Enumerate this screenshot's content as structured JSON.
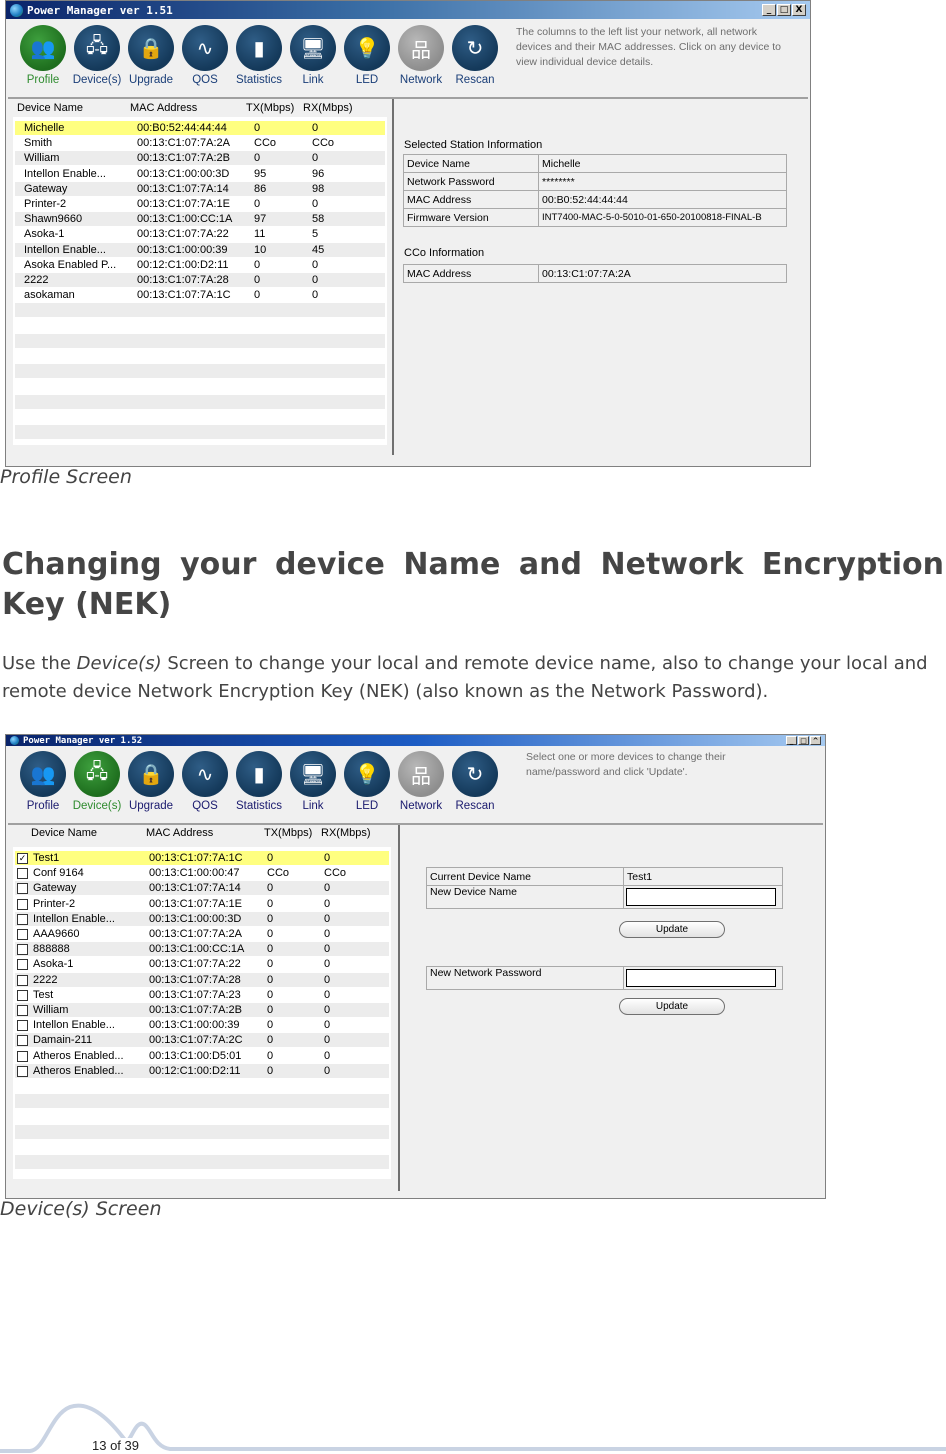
{
  "screen1": {
    "title": "Power Manager ver 1.51",
    "window_buttons": [
      "_",
      "□",
      "X"
    ],
    "toolbar": [
      {
        "label": "Profile",
        "icon": "profile-icon",
        "glyph": "👥",
        "active": true
      },
      {
        "label": "Device(s)",
        "icon": "devices-icon",
        "glyph": "🖧",
        "active": false
      },
      {
        "label": "Upgrade",
        "icon": "upgrade-icon",
        "glyph": "🔒",
        "active": false
      },
      {
        "label": "QOS",
        "icon": "qos-icon",
        "glyph": "∿",
        "active": false
      },
      {
        "label": "Statistics",
        "icon": "statistics-icon",
        "glyph": "▮",
        "active": false
      },
      {
        "label": "Link",
        "icon": "link-icon",
        "glyph": "🖥",
        "active": false
      },
      {
        "label": "LED",
        "icon": "led-icon",
        "glyph": "💡",
        "active": false
      },
      {
        "label": "Network",
        "icon": "network-icon",
        "glyph": "品",
        "active": false,
        "disabled": true
      },
      {
        "label": "Rescan",
        "icon": "rescan-icon",
        "glyph": "↻",
        "active": false
      }
    ],
    "hint": "The columns to the left list your network, all network devices and their MAC addresses. Click on any device to view individual device details.",
    "columns": [
      "Device Name",
      "MAC Address",
      "TX(Mbps)",
      "RX(Mbps)"
    ],
    "rows": [
      {
        "name": "Michelle",
        "mac": "00:B0:52:44:44:44",
        "tx": "0",
        "rx": "0",
        "selected": true
      },
      {
        "name": "Smith",
        "mac": "00:13:C1:07:7A:2A",
        "tx": "CCo",
        "rx": "CCo"
      },
      {
        "name": "William",
        "mac": "00:13:C1:07:7A:2B",
        "tx": "0",
        "rx": "0"
      },
      {
        "name": "Intellon Enable...",
        "mac": "00:13:C1:00:00:3D",
        "tx": "95",
        "rx": "96"
      },
      {
        "name": "Gateway",
        "mac": "00:13:C1:07:7A:14",
        "tx": "86",
        "rx": "98"
      },
      {
        "name": "Printer-2",
        "mac": "00:13:C1:07:7A:1E",
        "tx": "0",
        "rx": "0"
      },
      {
        "name": "Shawn9660",
        "mac": "00:13:C1:00:CC:1A",
        "tx": "97",
        "rx": "58"
      },
      {
        "name": "Asoka-1",
        "mac": "00:13:C1:07:7A:22",
        "tx": "11",
        "rx": "5"
      },
      {
        "name": "Intellon Enable...",
        "mac": "00:13:C1:00:00:39",
        "tx": "10",
        "rx": "45"
      },
      {
        "name": "Asoka Enabled P...",
        "mac": "00:12:C1:00:D2:11",
        "tx": "0",
        "rx": "0"
      },
      {
        "name": "2222",
        "mac": "00:13:C1:07:7A:28",
        "tx": "0",
        "rx": "0"
      },
      {
        "name": "asokaman",
        "mac": "00:13:C1:07:7A:1C",
        "tx": "0",
        "rx": "0"
      }
    ],
    "empty_rows": 10,
    "station_info": {
      "title": "Selected Station Information",
      "fields": [
        {
          "label": "Device Name",
          "value": "Michelle"
        },
        {
          "label": "Network Password",
          "value": "********"
        },
        {
          "label": "MAC Address",
          "value": "00:B0:52:44:44:44"
        },
        {
          "label": "Firmware Version",
          "value": "INT7400-MAC-5-0-5010-01-650-20100818-FINAL-B"
        }
      ]
    },
    "cco_info": {
      "title": "CCo Information",
      "fields": [
        {
          "label": "MAC Address",
          "value": "00:13:C1:07:7A:2A"
        }
      ]
    },
    "caption": "Profile Screen"
  },
  "section": {
    "heading_line1_words": [
      "Changing",
      "your",
      "device",
      "Name",
      "and",
      "Network",
      "Encryption"
    ],
    "heading_line2": "Key (NEK)",
    "para_pre": "Use the ",
    "para_em": "Device(s)",
    "para_post": " Screen to change your local and remote device name, also to change your local and remote device Network Encryption Key (NEK) (also known as the Network Password)."
  },
  "screen2": {
    "title": "Power Manager ver 1.52",
    "window_buttons": [
      "_",
      "□",
      "^"
    ],
    "toolbar": [
      {
        "label": "Profile",
        "icon": "profile-icon",
        "glyph": "👥",
        "active": false
      },
      {
        "label": "Device(s)",
        "icon": "devices-icon",
        "glyph": "🖧",
        "active": true
      },
      {
        "label": "Upgrade",
        "icon": "upgrade-icon",
        "glyph": "🔒",
        "active": false
      },
      {
        "label": "QOS",
        "icon": "qos-icon",
        "glyph": "∿",
        "active": false
      },
      {
        "label": "Statistics",
        "icon": "statistics-icon",
        "glyph": "▮",
        "active": false
      },
      {
        "label": "Link",
        "icon": "link-icon",
        "glyph": "🖥",
        "active": false
      },
      {
        "label": "LED",
        "icon": "led-icon",
        "glyph": "💡",
        "active": false
      },
      {
        "label": "Network",
        "icon": "network-icon",
        "glyph": "品",
        "active": false,
        "disabled": true
      },
      {
        "label": "Rescan",
        "icon": "rescan-icon",
        "glyph": "↻",
        "active": false
      }
    ],
    "hint": "Select one or more devices to change their name/password and click 'Update'.",
    "columns": [
      "Device Name",
      "MAC Address",
      "TX(Mbps)",
      "RX(Mbps)"
    ],
    "rows": [
      {
        "name": "Test1",
        "mac": "00:13:C1:07:7A:1C",
        "tx": "0",
        "rx": "0",
        "selected": true,
        "checked": true
      },
      {
        "name": "Conf 9164",
        "mac": "00:13:C1:00:00:47",
        "tx": "CCo",
        "rx": "CCo",
        "checked": false
      },
      {
        "name": "Gateway",
        "mac": "00:13:C1:07:7A:14",
        "tx": "0",
        "rx": "0",
        "checked": false
      },
      {
        "name": "Printer-2",
        "mac": "00:13:C1:07:7A:1E",
        "tx": "0",
        "rx": "0",
        "checked": false
      },
      {
        "name": "Intellon Enable...",
        "mac": "00:13:C1:00:00:3D",
        "tx": "0",
        "rx": "0",
        "checked": false
      },
      {
        "name": "AAA9660",
        "mac": "00:13:C1:07:7A:2A",
        "tx": "0",
        "rx": "0",
        "checked": false
      },
      {
        "name": "888888",
        "mac": "00:13:C1:00:CC:1A",
        "tx": "0",
        "rx": "0",
        "checked": false
      },
      {
        "name": "Asoka-1",
        "mac": "00:13:C1:07:7A:22",
        "tx": "0",
        "rx": "0",
        "checked": false
      },
      {
        "name": "2222",
        "mac": "00:13:C1:07:7A:28",
        "tx": "0",
        "rx": "0",
        "checked": false
      },
      {
        "name": "Test",
        "mac": "00:13:C1:07:7A:23",
        "tx": "0",
        "rx": "0",
        "checked": false
      },
      {
        "name": "William",
        "mac": "00:13:C1:07:7A:2B",
        "tx": "0",
        "rx": "0",
        "checked": false
      },
      {
        "name": "Intellon Enable...",
        "mac": "00:13:C1:00:00:39",
        "tx": "0",
        "rx": "0",
        "checked": false
      },
      {
        "name": "Damain-211",
        "mac": "00:13:C1:07:7A:2C",
        "tx": "0",
        "rx": "0",
        "checked": false
      },
      {
        "name": "Atheros Enabled...",
        "mac": "00:13:C1:00:D5:01",
        "tx": "0",
        "rx": "0",
        "checked": false
      },
      {
        "name": "Atheros Enabled...",
        "mac": "00:12:C1:00:D2:11",
        "tx": "0",
        "rx": "0",
        "checked": false
      }
    ],
    "empty_rows": 7,
    "form": {
      "current_name_label": "Current Device Name",
      "current_name_value": "Test1",
      "new_name_label": "New Device Name",
      "new_name_value": "",
      "update_label": "Update",
      "new_password_label": "New Network Password",
      "new_password_value": "",
      "update2_label": "Update"
    },
    "caption": "Device(s) Screen"
  },
  "footer": {
    "page": "13 of 39"
  }
}
